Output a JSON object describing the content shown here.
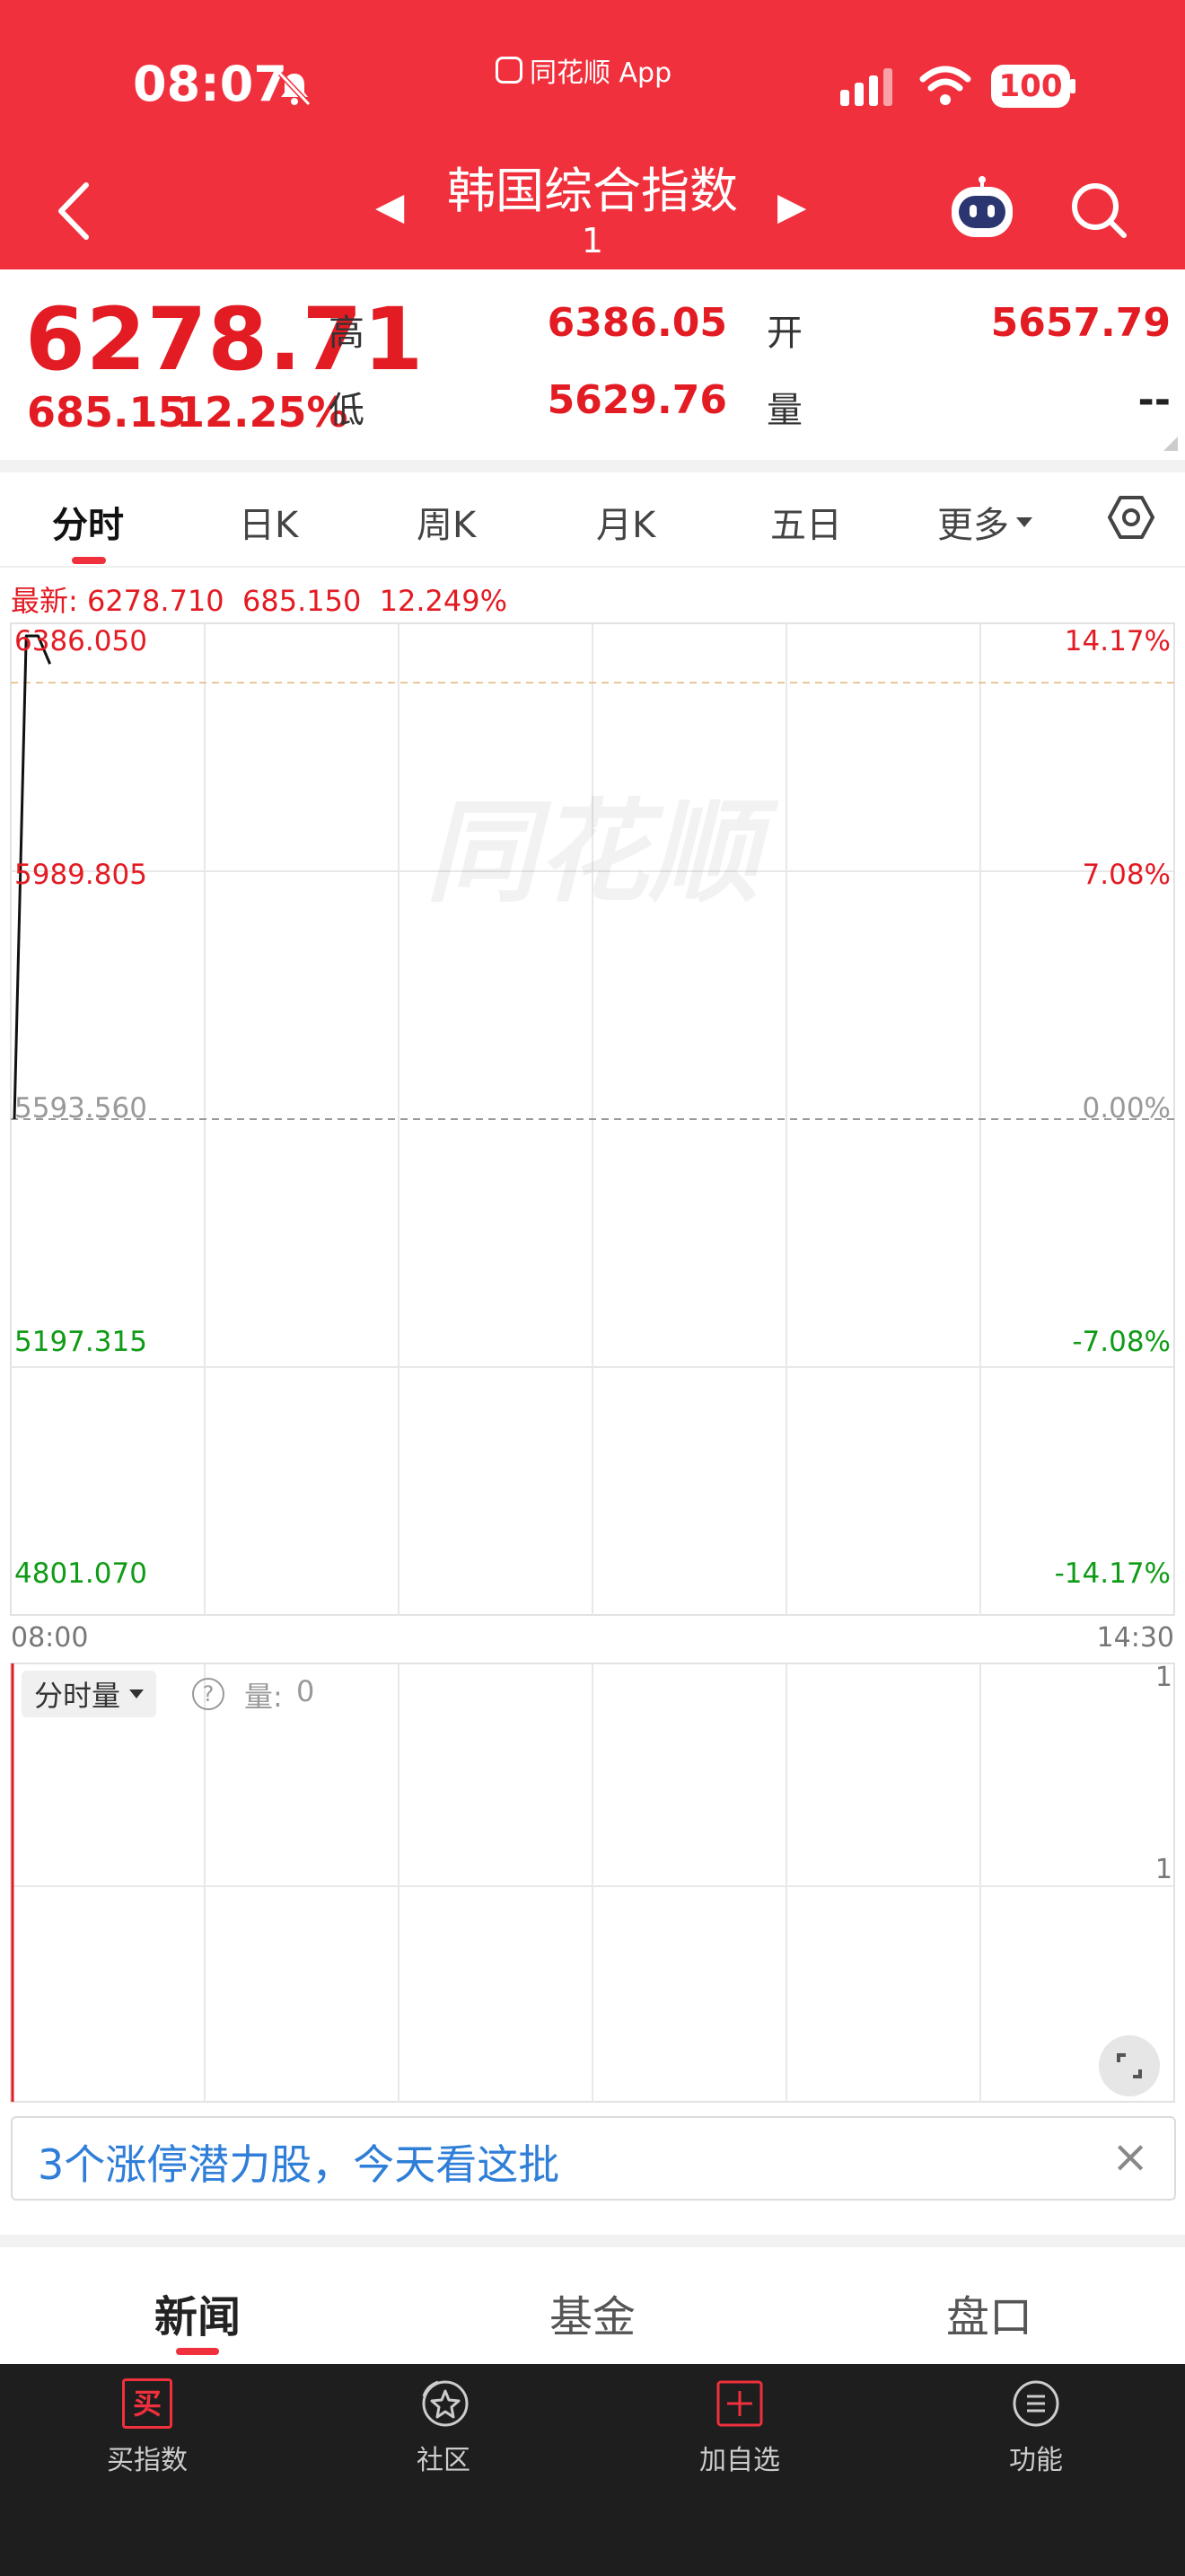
{
  "status_bar": {
    "time": "08:07",
    "center_app": "同花顺 App",
    "battery": "100"
  },
  "header": {
    "title": "韩国综合指数",
    "subtitle": "1",
    "prev_arrow": "◀",
    "next_arrow": "▶"
  },
  "quote": {
    "price": "6278.71",
    "change": "685.15",
    "change_pct": "12.25%",
    "high_label": "高",
    "high": "6386.05",
    "low_label": "低",
    "low": "5629.76",
    "open_label": "开",
    "open": "5657.79",
    "volume_label": "量",
    "volume": "--"
  },
  "tabs": {
    "items": [
      "分时",
      "日K",
      "周K",
      "月K",
      "五日",
      "更多"
    ],
    "active": "分时"
  },
  "chart": {
    "latest": "最新: 6278.710  685.150  12.249%",
    "watermark": "同花顺",
    "left_axis": [
      "6386.050",
      "5989.805",
      "5593.560",
      "5197.315",
      "4801.070"
    ],
    "right_axis": [
      "14.17%",
      "7.08%",
      "0.00%",
      "-7.08%",
      "-14.17%"
    ],
    "start_time": "08:00",
    "end_time": "14:30"
  },
  "chart_data": {
    "type": "line",
    "title": "",
    "xlabel": "",
    "ylabel": "",
    "x": [
      "08:00",
      "08:01",
      "08:02",
      "08:03"
    ],
    "series": [
      {
        "values": [
          5593.56,
          6386.05,
          6386.05,
          6340.0
        ]
      }
    ],
    "ylim": [
      4801.07,
      6386.05
    ],
    "xlim": [
      "08:00",
      "14:30"
    ],
    "grid": true
  },
  "volume_panel": {
    "selector": "分时量",
    "help": "?",
    "label": "量:",
    "value": "0",
    "right_top": "1",
    "right_mid": "1"
  },
  "ad": {
    "text": "3个涨停潜力股，今天看这批",
    "close": "×"
  },
  "bottom_tabs": {
    "items": [
      "新闻",
      "基金",
      "盘口"
    ],
    "active": "新闻"
  },
  "bottom_bar": {
    "items": [
      "买指数",
      "社区",
      "加自选",
      "功能"
    ],
    "buy_icon_text": "买"
  },
  "colors": {
    "header_red": "#f0303c",
    "up_red": "#e31b23",
    "down_green": "#0f9b16"
  }
}
